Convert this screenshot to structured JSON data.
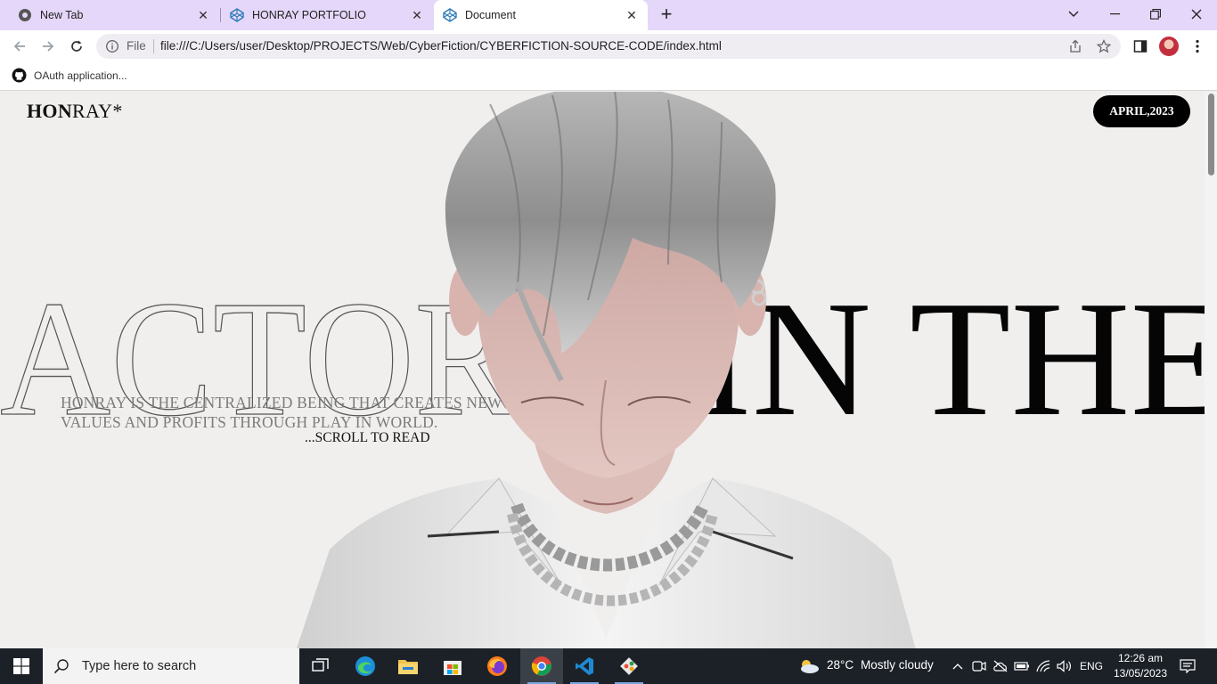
{
  "browser": {
    "tabs": [
      {
        "title": "New Tab",
        "active": false
      },
      {
        "title": "HONRAY PORTFOLIO",
        "active": false
      },
      {
        "title": "Document",
        "active": true
      }
    ],
    "address": {
      "scheme_label": "File",
      "url": "file:///C:/Users/user/Desktop/PROJECTS/Web/CyberFiction/CYBERFICTION-SOURCE-CODE/index.html"
    },
    "bookmarks": [
      {
        "label": "OAuth application..."
      }
    ],
    "accent": "#e5d7f9"
  },
  "page": {
    "brand_bold": "HON",
    "brand_rest": "RAY*",
    "date_badge": "APRIL,2023",
    "headline_outline": "ACTOR",
    "headline_solid": "IN THE",
    "description": "HONRAY IS THE CENTRALIZED BEING THAT CREATES NEW VALUES AND PROFITS THROUGH PLAY IN WORLD.",
    "scroll_hint": "...SCROLL TO READ"
  },
  "taskbar": {
    "search_placeholder": "Type here to search",
    "weather": {
      "temp": "28°C",
      "condition": "Mostly cloudy"
    },
    "language": "ENG",
    "time": "12:26 am",
    "date": "13/05/2023"
  }
}
